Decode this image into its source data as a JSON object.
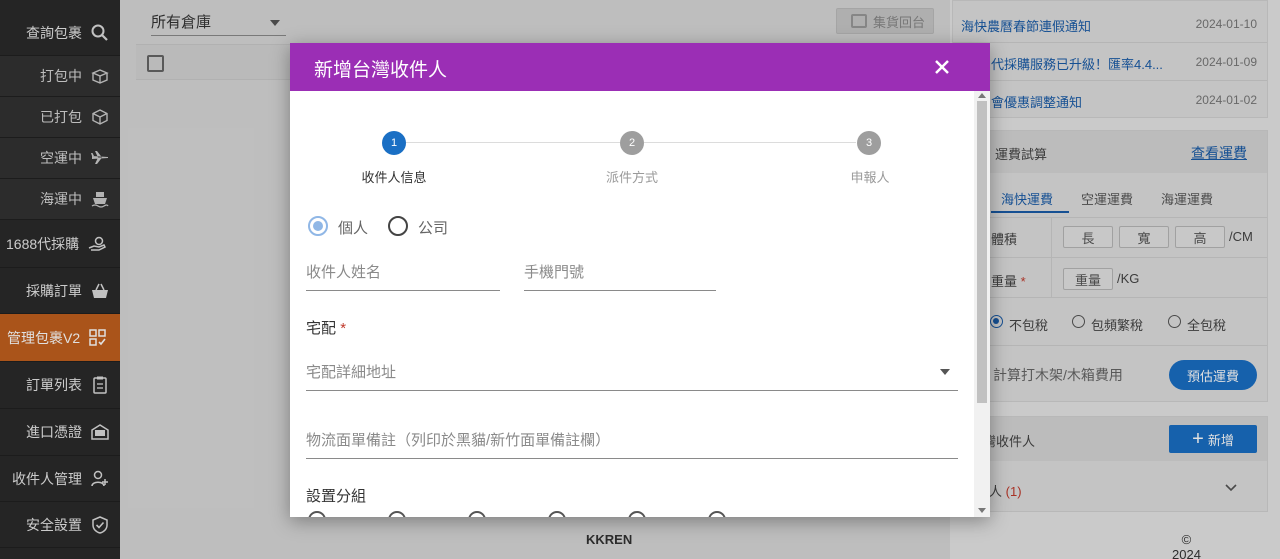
{
  "sidebar": {
    "items": [
      {
        "label": "查詢包裹",
        "icon": "search-icon"
      },
      {
        "label": "打包中",
        "icon": "box-open-icon"
      },
      {
        "label": "已打包",
        "icon": "box-icon"
      },
      {
        "label": "空運中",
        "icon": "airplane-icon"
      },
      {
        "label": "海運中",
        "icon": "ship-icon"
      },
      {
        "label": "1688代採購",
        "icon": "hand-coin-icon"
      },
      {
        "label": "採購訂單",
        "icon": "basket-icon"
      },
      {
        "label": "管理包裹V2",
        "icon": "grid-check-icon"
      },
      {
        "label": "訂單列表",
        "icon": "clipboard-icon"
      },
      {
        "label": "進口憑證",
        "icon": "certificate-icon"
      },
      {
        "label": "收件人管理",
        "icon": "user-add-icon"
      },
      {
        "label": "安全設置",
        "icon": "shield-check-icon"
      }
    ]
  },
  "main": {
    "warehouse_select": "所有倉庫",
    "ship_button": "集貨回台"
  },
  "news": [
    {
      "title": "海快農曆春節連假通知",
      "date": "2024-01-10"
    },
    {
      "title": "代採購服務已升級！匯率4.4...",
      "date": "2024-01-09"
    },
    {
      "title": "會優惠調整通知",
      "date": "2024-01-02"
    }
  ],
  "calc": {
    "title": "運費試算",
    "link": "查看運費",
    "tabs": [
      "海快運費",
      "空運運費",
      "海運運費"
    ],
    "volume_label": "體積",
    "dims": [
      "長",
      "寬",
      "高"
    ],
    "volume_unit": "/CM",
    "weight_label": "重量",
    "weight_req": "*",
    "weight_btn": "重量",
    "weight_unit": "/KG",
    "tax_options": [
      "不包稅",
      "包頻繁稅",
      "全包稅"
    ],
    "crate_label": "計算打木架/木箱費用",
    "estimate_button": "預估運費"
  },
  "recipients": {
    "title": "灣收件人",
    "add_button": "新增",
    "item_label": "人",
    "item_count": "(1)"
  },
  "footer": {
    "prefix": "© 2024 - ",
    "brand": "KKREN"
  },
  "modal": {
    "title": "新增台灣收件人",
    "steps": [
      {
        "num": "1",
        "label": "收件人信息"
      },
      {
        "num": "2",
        "label": "派件方式"
      },
      {
        "num": "3",
        "label": "申報人"
      }
    ],
    "type_options": [
      "個人",
      "公司"
    ],
    "name_placeholder": "收件人姓名",
    "phone_placeholder": "手機門號",
    "delivery_label": "宅配",
    "delivery_req": "*",
    "address_placeholder": "宅配詳細地址",
    "remark_placeholder": "物流面單備註（列印於黑貓/新竹面單備註欄）",
    "group_label": "設置分組"
  }
}
